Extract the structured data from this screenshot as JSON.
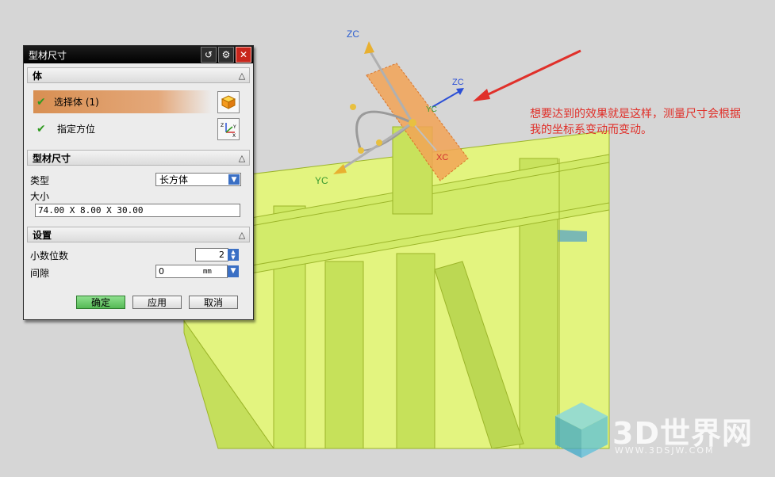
{
  "colors": {
    "model_fill": "#d6f06a",
    "model_line": "#9cb52a",
    "annotation": "#e0302a",
    "title_bar": "#000000",
    "selected_row": "#d88f52",
    "ok_button": "#6fcf6f"
  },
  "triad": {
    "zc": "ZC",
    "yc": "YC",
    "xc": "XC",
    "zc2": "ZC",
    "yc2": "YC"
  },
  "annotation": {
    "line1": "想要达到的效果就是这样，测量尺寸会根据",
    "line2": "我的坐标系变动而变动。"
  },
  "watermark": {
    "text": "3D世界网",
    "url": "WWW.3DSJW.COM"
  },
  "dialog": {
    "title": "型材尺寸",
    "title_icons": [
      "reset-icon",
      "gear-icon",
      "close-icon"
    ],
    "sections": {
      "body": {
        "label": "体",
        "select_body": "选择体 (1)",
        "specify_orientation": "指定方位"
      },
      "profile_size": {
        "label": "型材尺寸",
        "type_label": "类型",
        "type_value": "长方体",
        "size_label": "大小",
        "size_value": "74.00 X 8.00 X 30.00"
      },
      "settings": {
        "label": "设置",
        "decimals_label": "小数位数",
        "decimals_value": "2",
        "gap_label": "间隙",
        "gap_value": "0",
        "gap_unit": "mm"
      }
    },
    "buttons": {
      "ok": "确定",
      "apply": "应用",
      "cancel": "取消"
    }
  }
}
